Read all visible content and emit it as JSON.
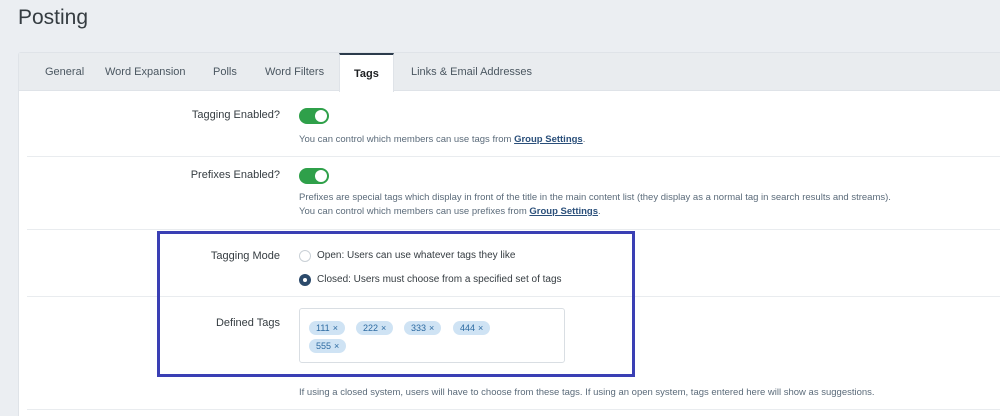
{
  "page": {
    "title": "Posting"
  },
  "tabs": [
    {
      "label": "General",
      "active": false
    },
    {
      "label": "Word Expansion",
      "active": false
    },
    {
      "label": "Polls",
      "active": false
    },
    {
      "label": "Word Filters",
      "active": false
    },
    {
      "label": "Tags",
      "active": true
    },
    {
      "label": "Links & Email Addresses",
      "active": false
    }
  ],
  "tagging_enabled": {
    "label": "Tagging Enabled?",
    "value": true,
    "desc_prefix": "You can control which members can use tags from ",
    "desc_link": "Group Settings",
    "desc_suffix": "."
  },
  "prefixes_enabled": {
    "label": "Prefixes Enabled?",
    "value": true,
    "desc_line1": "Prefixes are special tags which display in front of the title in the main content list (they display as a normal tag in search results and streams).",
    "desc_prefix": "You can control which members can use prefixes from ",
    "desc_link": "Group Settings",
    "desc_suffix": "."
  },
  "tagging_mode": {
    "label": "Tagging Mode",
    "options": [
      {
        "label": "Open: Users can use whatever tags they like",
        "selected": false
      },
      {
        "label": "Closed: Users must choose from a specified set of tags",
        "selected": true
      }
    ]
  },
  "defined_tags": {
    "label": "Defined Tags",
    "tags": [
      "111",
      "222",
      "333",
      "444",
      "555"
    ],
    "remove_glyph": "×",
    "desc": "If using a closed system, users will have to choose from these tags. If using an open system, tags entered here will show as suggestions."
  },
  "colors": {
    "toggle_on": "#2fa04a",
    "tag_bg": "#cfe3f4",
    "tag_text": "#2c6aa1",
    "highlight": "#3a3fb4"
  }
}
